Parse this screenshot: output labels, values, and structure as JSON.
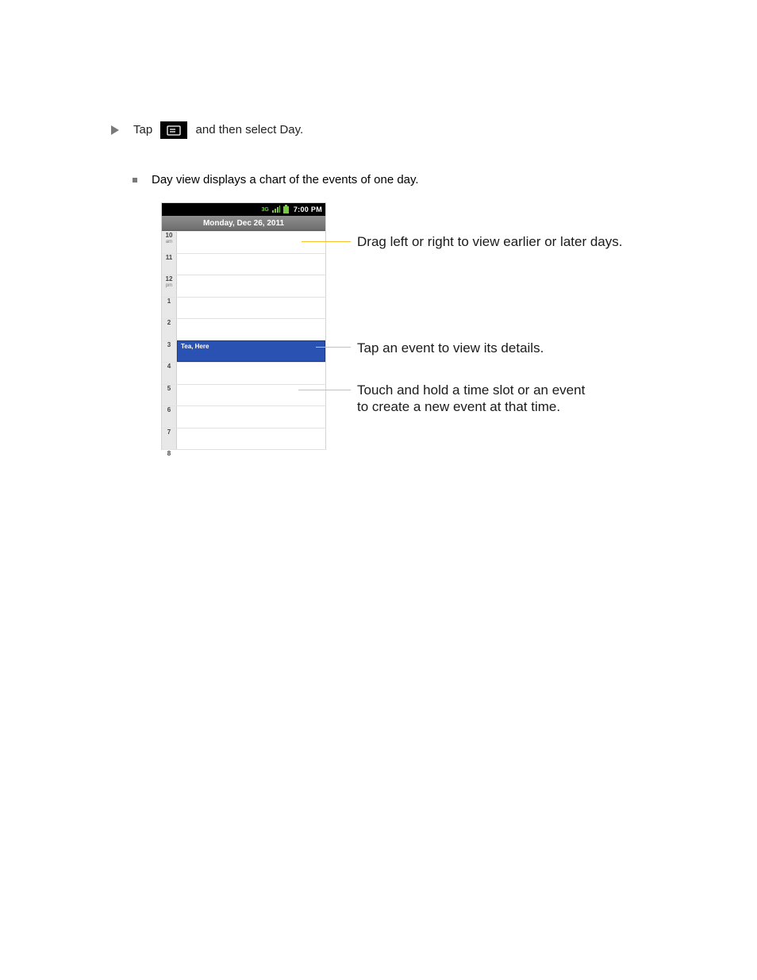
{
  "instruction": {
    "prefix": "Tap",
    "suffix": "and then select Day."
  },
  "sub_instruction": "Day view displays a chart of the events of one day.",
  "phone": {
    "status_time": "7:00 PM",
    "date": "Monday, Dec 26, 2011",
    "hours": [
      {
        "label": "10",
        "sub": "am"
      },
      {
        "label": "11",
        "sub": ""
      },
      {
        "label": "12",
        "sub": "pm"
      },
      {
        "label": "1",
        "sub": ""
      },
      {
        "label": "2",
        "sub": ""
      },
      {
        "label": "3",
        "sub": ""
      },
      {
        "label": "4",
        "sub": ""
      },
      {
        "label": "5",
        "sub": ""
      },
      {
        "label": "6",
        "sub": ""
      },
      {
        "label": "7",
        "sub": ""
      },
      {
        "label": "8",
        "sub": ""
      }
    ],
    "event": {
      "title": "Tea, Here",
      "hour_index": 5
    }
  },
  "callouts": {
    "c1": "Drag left or right to view earlier or later days.",
    "c2": "Tap an event to view its details.",
    "c3_line1": "Touch and hold a time slot or an event",
    "c3_line2": "to create a new event at that time."
  }
}
